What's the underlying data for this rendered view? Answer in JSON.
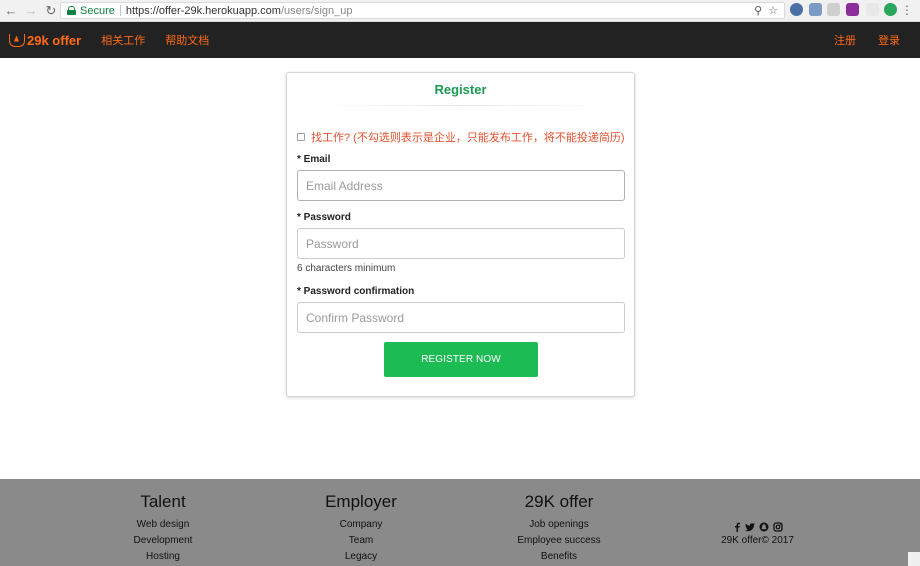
{
  "browser": {
    "secure_label": "Secure",
    "url_host": "https://offer-29k.herokuapp.com",
    "url_path": "/users/sign_up"
  },
  "navbar": {
    "brand": "29k offer",
    "links": [
      "相关工作",
      "帮助文档"
    ],
    "right_links": [
      "注册",
      "登录"
    ],
    "accent_color": "#ff6a14"
  },
  "form": {
    "title": "Register",
    "job_seeker_label": "找工作? (不勾选则表示是企业，只能发布工作，将不能投递简历)",
    "email_label": "* Email",
    "email_placeholder": "Email Address",
    "password_label": "* Password",
    "password_placeholder": "Password",
    "password_hint": "6 characters minimum",
    "confirm_label": "* Password confirmation",
    "confirm_placeholder": "Confirm Password",
    "submit_label": "REGISTER NOW",
    "title_color": "#1a9a52",
    "button_color": "#1cbb54"
  },
  "footer": {
    "columns": [
      {
        "heading": "Talent",
        "items": [
          "Web design",
          "Development",
          "Hosting"
        ]
      },
      {
        "heading": "Employer",
        "items": [
          "Company",
          "Team",
          "Legacy"
        ]
      },
      {
        "heading": "29K offer",
        "items": [
          "Job openings",
          "Employee success",
          "Benefits"
        ]
      }
    ],
    "social_icons": [
      "facebook-icon",
      "twitter-icon",
      "snapchat-icon",
      "instagram-icon"
    ],
    "copyright": "29K offer© 2017"
  }
}
